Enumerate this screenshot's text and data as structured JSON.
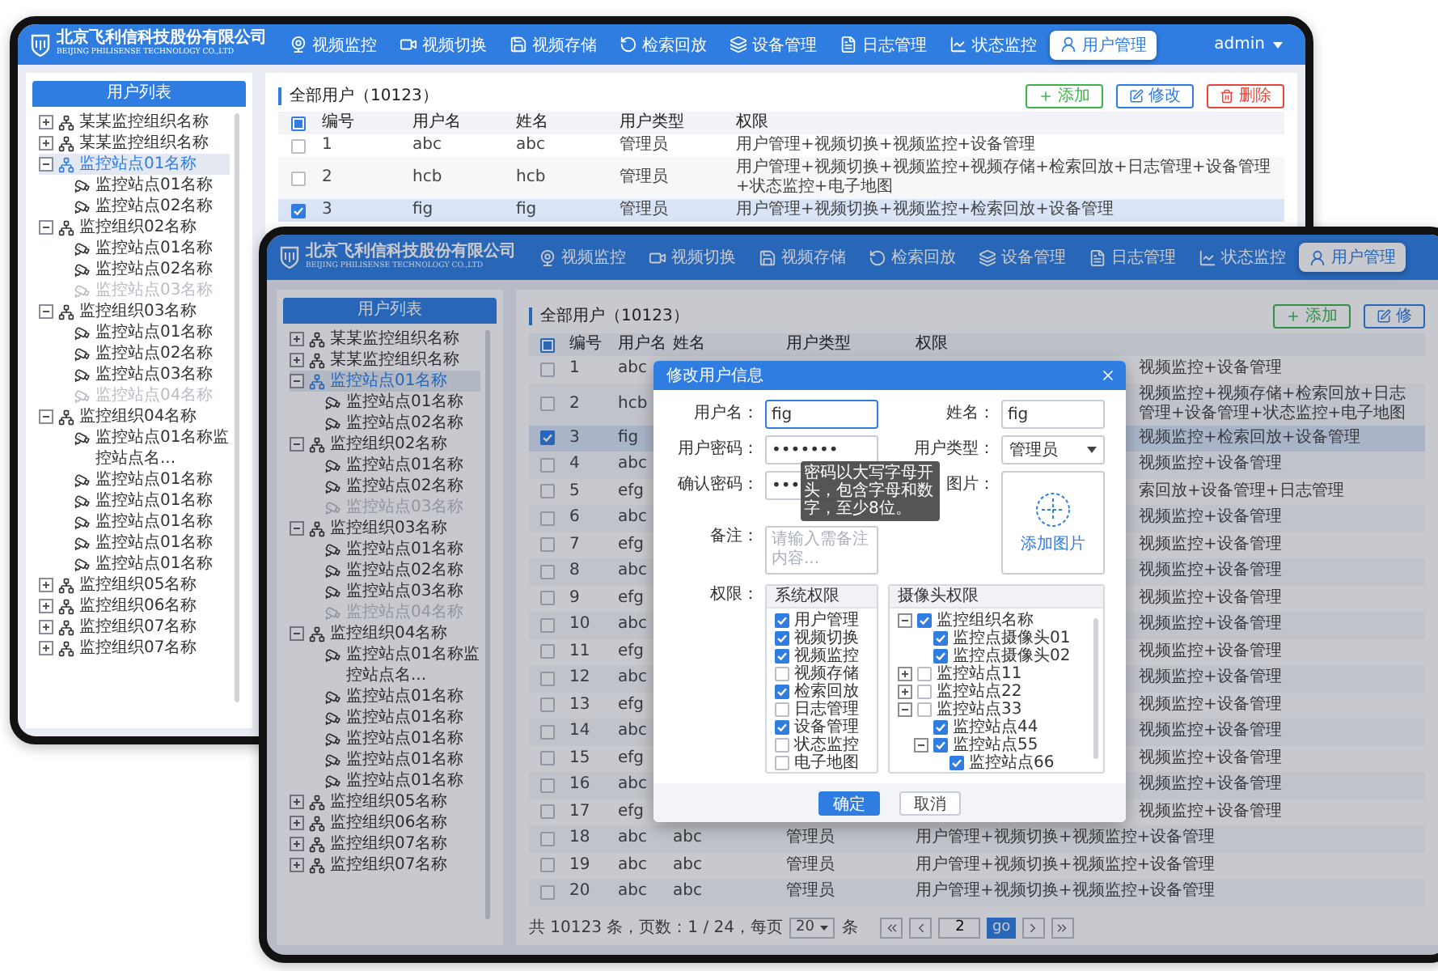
{
  "back_screen": {
    "header": {
      "company_name": "北京飞利信科技股份有限公司",
      "company_name_en": "BEIJING PHILISENSE TECHNOLOGY CO.,LTD",
      "nav": [
        {
          "label": "视频监控",
          "selected": false
        },
        {
          "label": "视频切换",
          "selected": false
        },
        {
          "label": "视频存储",
          "selected": false
        },
        {
          "label": "检索回放",
          "selected": false
        },
        {
          "label": "设备管理",
          "selected": false
        },
        {
          "label": "日志管理",
          "selected": false
        },
        {
          "label": "状态监控",
          "selected": false
        },
        {
          "label": "用户管理",
          "selected": true
        }
      ],
      "user": "admin"
    },
    "sidebar": {
      "title": "用户列表",
      "tree": [
        {
          "label": "某某监控组织名称",
          "kind": "org",
          "expanded": false,
          "selected": false,
          "disabled": false
        },
        {
          "label": "某某监控组织名称",
          "kind": "org",
          "expanded": false,
          "selected": false,
          "disabled": false
        },
        {
          "label": "监控站点01名称",
          "kind": "org",
          "expanded": true,
          "selected": true,
          "disabled": false,
          "children": [
            {
              "label": "监控站点01名称",
              "kind": "site",
              "selected": false,
              "disabled": false
            },
            {
              "label": "监控站点02名称",
              "kind": "site",
              "selected": false,
              "disabled": false
            }
          ]
        },
        {
          "label": "监控组织02名称",
          "kind": "org",
          "expanded": true,
          "selected": false,
          "disabled": false,
          "children": [
            {
              "label": "监控站点01名称",
              "kind": "site",
              "selected": false,
              "disabled": false
            },
            {
              "label": "监控站点02名称",
              "kind": "site",
              "selected": false,
              "disabled": false
            },
            {
              "label": "监控站点03名称",
              "kind": "site",
              "selected": false,
              "disabled": true
            }
          ]
        },
        {
          "label": "监控组织03名称",
          "kind": "org",
          "expanded": true,
          "selected": false,
          "disabled": false,
          "children": [
            {
              "label": "监控站点01名称",
              "kind": "site",
              "selected": false,
              "disabled": false
            },
            {
              "label": "监控站点02名称",
              "kind": "site",
              "selected": false,
              "disabled": false
            },
            {
              "label": "监控站点03名称",
              "kind": "site",
              "selected": false,
              "disabled": false
            },
            {
              "label": "监控站点04名称",
              "kind": "site",
              "selected": false,
              "disabled": true
            }
          ]
        },
        {
          "label": "监控组织04名称",
          "kind": "org",
          "expanded": true,
          "selected": false,
          "disabled": false,
          "children": [
            {
              "label": "监控站点01名称监控站点名...",
              "kind": "site",
              "selected": false,
              "disabled": false
            },
            {
              "label": "监控站点01名称",
              "kind": "site",
              "selected": false,
              "disabled": false
            },
            {
              "label": "监控站点01名称",
              "kind": "site",
              "selected": false,
              "disabled": false
            },
            {
              "label": "监控站点01名称",
              "kind": "site",
              "selected": false,
              "disabled": false
            },
            {
              "label": "监控站点01名称",
              "kind": "site",
              "selected": false,
              "disabled": false
            },
            {
              "label": "监控站点01名称",
              "kind": "site",
              "selected": false,
              "disabled": false
            }
          ]
        },
        {
          "label": "监控组织05名称",
          "kind": "org",
          "expanded": false,
          "selected": false,
          "disabled": false
        },
        {
          "label": "监控组织06名称",
          "kind": "org",
          "expanded": false,
          "selected": false,
          "disabled": false
        },
        {
          "label": "监控组织07名称",
          "kind": "org",
          "expanded": false,
          "selected": false,
          "disabled": false
        },
        {
          "label": "监控组织07名称",
          "kind": "org",
          "expanded": false,
          "selected": false,
          "disabled": false
        }
      ]
    },
    "toolbar": {
      "title": "全部用户（10123）",
      "buttons": [
        {
          "label": "添加",
          "kind": "add"
        },
        {
          "label": "修改",
          "kind": "edit"
        },
        {
          "label": "删除",
          "kind": "delete"
        }
      ]
    },
    "table": {
      "select_all": {
        "partial": true
      },
      "columns": [
        "编号",
        "用户名",
        "姓名",
        "用户类型",
        "权限"
      ],
      "rows": [
        {
          "number": "1",
          "username": "abc",
          "name": "abc",
          "type": "管理员",
          "permissions": "用户管理+视频切换+视频监控+设备管理",
          "checked": false,
          "selected": false
        },
        {
          "number": "2",
          "username": "hcb",
          "name": "hcb",
          "type": "管理员",
          "permissions": "用户管理+视频切换+视频监控+视频存储+检索回放+日志管理+设备管理+状态监控+电子地图",
          "checked": false,
          "selected": false
        },
        {
          "number": "3",
          "username": "fig",
          "name": "fig",
          "type": "管理员",
          "permissions": "用户管理+视频切换+视频监控+检索回放+设备管理",
          "checked": true,
          "selected": true
        }
      ]
    }
  },
  "front_screen": {
    "header": {
      "company_name": "北京飞利信科技股份有限公司",
      "company_name_en": "BEIJING PHILISENSE TECHNOLOGY CO.,LTD",
      "nav": [
        {
          "label": "视频监控",
          "selected": false
        },
        {
          "label": "视频切换",
          "selected": false
        },
        {
          "label": "视频存储",
          "selected": false
        },
        {
          "label": "检索回放",
          "selected": false
        },
        {
          "label": "设备管理",
          "selected": false
        },
        {
          "label": "日志管理",
          "selected": false
        },
        {
          "label": "状态监控",
          "selected": false
        },
        {
          "label": "用户管理",
          "selected": true
        }
      ]
    },
    "sidebar": {
      "title": "用户列表",
      "tree": [
        {
          "label": "某某监控组织名称",
          "kind": "org",
          "expanded": false,
          "selected": false,
          "disabled": false
        },
        {
          "label": "某某监控组织名称",
          "kind": "org",
          "expanded": false,
          "selected": false,
          "disabled": false
        },
        {
          "label": "监控站点01名称",
          "kind": "org",
          "expanded": true,
          "selected": true,
          "disabled": false,
          "children": [
            {
              "label": "监控站点01名称",
              "kind": "site",
              "selected": false,
              "disabled": false
            },
            {
              "label": "监控站点02名称",
              "kind": "site",
              "selected": false,
              "disabled": false
            }
          ]
        },
        {
          "label": "监控组织02名称",
          "kind": "org",
          "expanded": true,
          "selected": false,
          "disabled": false,
          "children": [
            {
              "label": "监控站点01名称",
              "kind": "site",
              "selected": false,
              "disabled": false
            },
            {
              "label": "监控站点02名称",
              "kind": "site",
              "selected": false,
              "disabled": false
            },
            {
              "label": "监控站点03名称",
              "kind": "site",
              "selected": false,
              "disabled": true
            }
          ]
        },
        {
          "label": "监控组织03名称",
          "kind": "org",
          "expanded": true,
          "selected": false,
          "disabled": false,
          "children": [
            {
              "label": "监控站点01名称",
              "kind": "site",
              "selected": false,
              "disabled": false
            },
            {
              "label": "监控站点02名称",
              "kind": "site",
              "selected": false,
              "disabled": false
            },
            {
              "label": "监控站点03名称",
              "kind": "site",
              "selected": false,
              "disabled": false
            },
            {
              "label": "监控站点04名称",
              "kind": "site",
              "selected": false,
              "disabled": true
            }
          ]
        },
        {
          "label": "监控组织04名称",
          "kind": "org",
          "expanded": true,
          "selected": false,
          "disabled": false,
          "children": [
            {
              "label": "监控站点01名称监控站点名...",
              "kind": "site",
              "selected": false,
              "disabled": false
            },
            {
              "label": "监控站点01名称",
              "kind": "site",
              "selected": false,
              "disabled": false
            },
            {
              "label": "监控站点01名称",
              "kind": "site",
              "selected": false,
              "disabled": false
            },
            {
              "label": "监控站点01名称",
              "kind": "site",
              "selected": false,
              "disabled": false
            },
            {
              "label": "监控站点01名称",
              "kind": "site",
              "selected": false,
              "disabled": false
            },
            {
              "label": "监控站点01名称",
              "kind": "site",
              "selected": false,
              "disabled": false
            }
          ]
        },
        {
          "label": "监控组织05名称",
          "kind": "org",
          "expanded": false,
          "selected": false,
          "disabled": false
        },
        {
          "label": "监控组织06名称",
          "kind": "org",
          "expanded": false,
          "selected": false,
          "disabled": false
        },
        {
          "label": "监控组织07名称",
          "kind": "org",
          "expanded": false,
          "selected": false,
          "disabled": false
        },
        {
          "label": "监控组织07名称",
          "kind": "org",
          "expanded": false,
          "selected": false,
          "disabled": false
        }
      ]
    },
    "toolbar": {
      "title": "全部用户（10123）",
      "buttons": [
        {
          "label": "添加",
          "kind": "add"
        },
        {
          "label": "修",
          "kind": "edit"
        }
      ]
    },
    "table": {
      "select_all": {
        "partial": true
      },
      "columns": [
        "编号",
        "用户名",
        "姓名",
        "用户类型",
        "权限"
      ],
      "rows": [
        {
          "kind": "covered",
          "number": "1",
          "username": "abc",
          "permissions": "视频监控+设备管理",
          "checked": false,
          "selected": false
        },
        {
          "kind": "covered",
          "number": "2",
          "username": "hcb",
          "permissions": "视频监控+视频存储+检索回放+日志管理+设备管理+状态监控+电子地图",
          "checked": false,
          "selected": false
        },
        {
          "kind": "covered",
          "number": "3",
          "username": "fig",
          "permissions": "视频监控+检索回放+设备管理",
          "checked": true,
          "selected": true
        },
        {
          "kind": "covered",
          "number": "4",
          "username": "abc",
          "permissions": "视频监控+设备管理",
          "checked": false,
          "selected": false
        },
        {
          "kind": "covered",
          "number": "5",
          "username": "efg",
          "permissions": "索回放+设备管理+日志管理",
          "checked": false,
          "selected": false
        },
        {
          "kind": "covered",
          "number": "6",
          "username": "abc",
          "permissions": "视频监控+设备管理",
          "checked": false,
          "selected": false
        },
        {
          "kind": "covered",
          "number": "7",
          "username": "efg",
          "permissions": "视频监控+设备管理",
          "checked": false,
          "selected": false
        },
        {
          "kind": "covered",
          "number": "8",
          "username": "abc",
          "permissions": "视频监控+设备管理",
          "checked": false,
          "selected": false
        },
        {
          "kind": "covered",
          "number": "9",
          "username": "efg",
          "permissions": "视频监控+设备管理",
          "checked": false,
          "selected": false
        },
        {
          "kind": "covered",
          "number": "10",
          "username": "abc",
          "permissions": "视频监控+设备管理",
          "checked": false,
          "selected": false
        },
        {
          "kind": "covered",
          "number": "11",
          "username": "efg",
          "permissions": "视频监控+设备管理",
          "checked": false,
          "selected": false
        },
        {
          "kind": "covered",
          "number": "12",
          "username": "abc",
          "permissions": "视频监控+设备管理",
          "checked": false,
          "selected": false
        },
        {
          "kind": "covered",
          "number": "13",
          "username": "efg",
          "permissions": "视频监控+设备管理",
          "checked": false,
          "selected": false
        },
        {
          "kind": "covered",
          "number": "14",
          "username": "abc",
          "permissions": "视频监控+设备管理",
          "checked": false,
          "selected": false
        },
        {
          "kind": "covered",
          "number": "15",
          "username": "efg",
          "permissions": "视频监控+设备管理",
          "checked": false,
          "selected": false
        },
        {
          "kind": "covered",
          "number": "16",
          "username": "abc",
          "permissions": "视频监控+设备管理",
          "checked": false,
          "selected": false
        },
        {
          "kind": "covered",
          "number": "17",
          "username": "efg",
          "permissions": "视频监控+设备管理",
          "checked": false,
          "selected": false
        },
        {
          "kind": "full",
          "number": "18",
          "username": "abc",
          "name": "abc",
          "type": "管理员",
          "permissions": "用户管理+视频切换+视频监控+设备管理",
          "checked": false,
          "selected": false
        },
        {
          "kind": "full",
          "number": "19",
          "username": "abc",
          "name": "abc",
          "type": "管理员",
          "permissions": "用户管理+视频切换+视频监控+设备管理",
          "checked": false,
          "selected": false
        },
        {
          "kind": "full",
          "number": "20",
          "username": "abc",
          "name": "abc",
          "type": "管理员",
          "permissions": "用户管理+视频切换+视频监控+设备管理",
          "checked": false,
          "selected": false
        }
      ]
    },
    "footer": {
      "summary": "共 10123 条，页数：1 / 24，每页",
      "page_size": "20",
      "page_size_unit": "条",
      "page_input": "2",
      "go": "go"
    },
    "dialog": {
      "title": "修改用户信息",
      "username": {
        "label": "用户名：",
        "value": "fig",
        "focused": true
      },
      "name": {
        "label": "姓名：",
        "value": "fig"
      },
      "password": {
        "label": "用户密码：",
        "value": "•••••••"
      },
      "user_type": {
        "label": "用户类型：",
        "value": "管理员"
      },
      "confirm_password": {
        "label": "确认密码：",
        "value": "•••"
      },
      "tooltip": "密码以大写字母开头，包含字母和数字，至少8位。",
      "picture": {
        "label": "图片：",
        "action": "添加图片"
      },
      "remark": {
        "label": "备注：",
        "placeholder": "请输入需备注内容..."
      },
      "permissions": {
        "label": "权限：",
        "system": {
          "title": "系统权限",
          "items": [
            {
              "label": "用户管理",
              "checked": true
            },
            {
              "label": "视频切换",
              "checked": true
            },
            {
              "label": "视频监控",
              "checked": true
            },
            {
              "label": "视频存储",
              "checked": false
            },
            {
              "label": "检索回放",
              "checked": true
            },
            {
              "label": "日志管理",
              "checked": false
            },
            {
              "label": "设备管理",
              "checked": true
            },
            {
              "label": "状态监控",
              "checked": false
            },
            {
              "label": "电子地图",
              "checked": false
            }
          ]
        },
        "camera": {
          "title": "摄像头权限",
          "tree": [
            {
              "label": "监控组织名称",
              "kind": "group",
              "expanded": true,
              "checked": true,
              "children": [
                {
                  "label": "监控点摄像头01",
                  "kind": "leaf",
                  "checked": true
                },
                {
                  "label": "监控点摄像头02",
                  "kind": "leaf",
                  "checked": true
                }
              ]
            },
            {
              "label": "监控站点11",
              "kind": "group",
              "expanded": false,
              "checked": false
            },
            {
              "label": "监控站点22",
              "kind": "group",
              "expanded": false,
              "checked": false
            },
            {
              "label": "监控站点33",
              "kind": "group",
              "expanded": true,
              "checked": false,
              "children": [
                {
                  "label": "监控站点44",
                  "kind": "leaf",
                  "checked": true
                },
                {
                  "label": "监控站点55",
                  "kind": "group",
                  "expanded": true,
                  "checked": true,
                  "children": [
                    {
                      "label": "监控站点66",
                      "kind": "leaf",
                      "checked": true
                    }
                  ]
                }
              ]
            }
          ]
        }
      },
      "buttons": [
        {
          "label": "确定",
          "kind": "primary"
        },
        {
          "label": "取消",
          "kind": "secondary"
        }
      ]
    }
  }
}
